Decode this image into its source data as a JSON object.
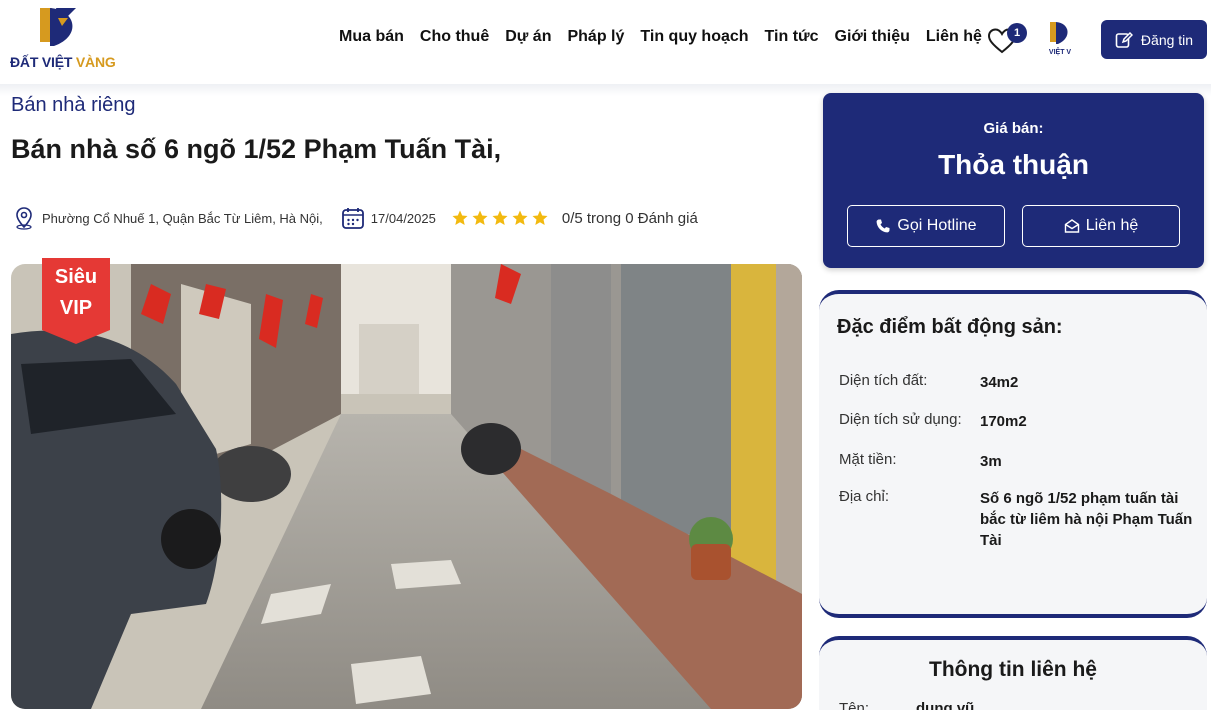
{
  "brand": {
    "logo_word1": "ĐẤT VIỆT",
    "logo_word2": "VÀNG",
    "colors": {
      "primary": "#1e2a78",
      "gold": "#d69a1f",
      "star": "#f2b90f",
      "vip": "#e53935"
    }
  },
  "nav": {
    "items": [
      {
        "label": "Mua bán"
      },
      {
        "label": "Cho thuê"
      },
      {
        "label": "Dự án"
      },
      {
        "label": "Pháp lý"
      },
      {
        "label": "Tin quy hoạch"
      },
      {
        "label": "Tin tức"
      },
      {
        "label": "Giới thiệu"
      },
      {
        "label": "Liên hệ"
      }
    ],
    "favorites_count": "1",
    "avatar_label": "VIỆT V",
    "post_button": "Đăng tin"
  },
  "listing": {
    "category": "Bán nhà riêng",
    "title": "Bán nhà số 6 ngõ 1/52 Phạm Tuấn Tài,",
    "location": "Phường Cổ Nhuế 1, Quận Bắc Từ Liêm, Hà Nội,",
    "date": "17/04/2025",
    "stars": 5,
    "rating_text": "0/5 trong 0 Đánh giá",
    "vip_line1": "Siêu",
    "vip_line2": "VIP"
  },
  "price_card": {
    "label": "Giá bán:",
    "value": "Thỏa thuận",
    "hotline_button": "Gọi Hotline",
    "contact_button": "Liên hệ"
  },
  "features": {
    "title": "Đặc điểm bất động sản:",
    "rows": [
      {
        "key": "Diện tích đất:",
        "value": "34m2"
      },
      {
        "key": "Diện tích sử dụng:",
        "value": "170m2"
      },
      {
        "key": "Mặt tiền:",
        "value": "3m"
      },
      {
        "key": "Địa chỉ:",
        "value": "Số 6 ngõ 1/52 phạm tuấn tài bắc từ liêm hà nội Phạm Tuấn Tài"
      }
    ]
  },
  "contact": {
    "title": "Thông tin liên hệ",
    "name_label": "Tên:",
    "name_value": "dung vũ"
  }
}
